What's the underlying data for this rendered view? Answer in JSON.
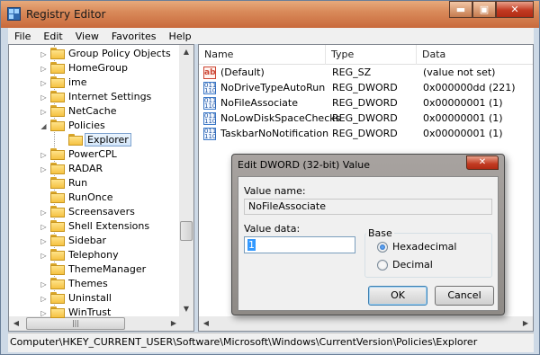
{
  "window": {
    "title": "Registry Editor",
    "controls": {
      "minimize": "▬",
      "maximize": "▣",
      "close": "✕"
    }
  },
  "menu": [
    "File",
    "Edit",
    "View",
    "Favorites",
    "Help"
  ],
  "tree": {
    "items": [
      {
        "label": "Group Policy Objects",
        "expander": "▷",
        "selected": false
      },
      {
        "label": "HomeGroup",
        "expander": "▷",
        "selected": false
      },
      {
        "label": "ime",
        "expander": "▷",
        "selected": false
      },
      {
        "label": "Internet Settings",
        "expander": "▷",
        "selected": false
      },
      {
        "label": "NetCache",
        "expander": "▷",
        "selected": false
      },
      {
        "label": "Policies",
        "expander": "◢",
        "selected": false
      },
      {
        "label": "Explorer",
        "expander": "",
        "selected": true
      },
      {
        "label": "PowerCPL",
        "expander": "▷",
        "selected": false
      },
      {
        "label": "RADAR",
        "expander": "▷",
        "selected": false
      },
      {
        "label": "Run",
        "expander": "",
        "selected": false
      },
      {
        "label": "RunOnce",
        "expander": "",
        "selected": false
      },
      {
        "label": "Screensavers",
        "expander": "▷",
        "selected": false
      },
      {
        "label": "Shell Extensions",
        "expander": "▷",
        "selected": false
      },
      {
        "label": "Sidebar",
        "expander": "▷",
        "selected": false
      },
      {
        "label": "Telephony",
        "expander": "▷",
        "selected": false
      },
      {
        "label": "ThemeManager",
        "expander": "",
        "selected": false
      },
      {
        "label": "Themes",
        "expander": "▷",
        "selected": false
      },
      {
        "label": "Uninstall",
        "expander": "▷",
        "selected": false
      },
      {
        "label": "WinTrust",
        "expander": "▷",
        "selected": false
      }
    ]
  },
  "values_list": {
    "columns": [
      "Name",
      "Type",
      "Data"
    ],
    "rows": [
      {
        "icon": "ab",
        "name": "(Default)",
        "type": "REG_SZ",
        "data": "(value not set)"
      },
      {
        "icon": "binary",
        "name": "NoDriveTypeAutoRun",
        "type": "REG_DWORD",
        "data": "0x000000dd (221)"
      },
      {
        "icon": "binary",
        "name": "NoFileAssociate",
        "type": "REG_DWORD",
        "data": "0x00000001 (1)"
      },
      {
        "icon": "binary",
        "name": "NoLowDiskSpaceChecks",
        "type": "REG_DWORD",
        "data": "0x00000001 (1)"
      },
      {
        "icon": "binary",
        "name": "TaskbarNoNotification",
        "type": "REG_DWORD",
        "data": "0x00000001 (1)"
      }
    ]
  },
  "dialog": {
    "title": "Edit DWORD (32-bit) Value",
    "close": "✕",
    "value_name_label": "Value name:",
    "value_name": "NoFileAssociate",
    "value_data_label": "Value data:",
    "value_data": "1",
    "base_label": "Base",
    "radios": [
      {
        "label": "Hexadecimal",
        "checked": true
      },
      {
        "label": "Decimal",
        "checked": false
      }
    ],
    "ok": "OK",
    "cancel": "Cancel"
  },
  "status_path": "Computer\\HKEY_CURRENT_USER\\Software\\Microsoft\\Windows\\CurrentVersion\\Policies\\Explorer"
}
